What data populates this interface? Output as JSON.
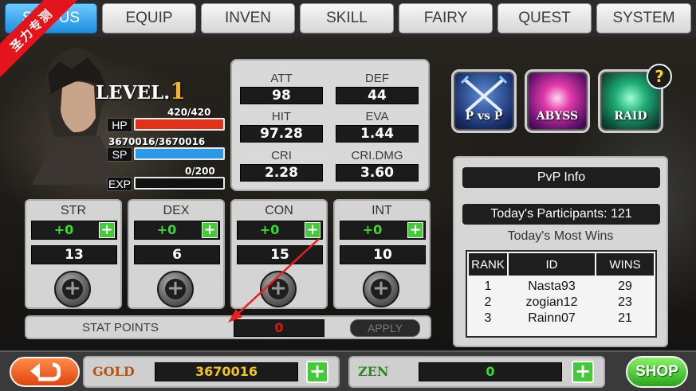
{
  "tabs": [
    {
      "label": "STATUS",
      "active": true
    },
    {
      "label": "EQUIP"
    },
    {
      "label": "INVEN"
    },
    {
      "label": "SKILL"
    },
    {
      "label": "FAIRY"
    },
    {
      "label": "QUEST"
    },
    {
      "label": "SYSTEM"
    }
  ],
  "watermark": "圣力专测",
  "character": {
    "level_label": "LEVEL.",
    "level": "1",
    "hp_label": "HP",
    "hp_value": "420/420",
    "hp_fraction": 1.0,
    "sp_label": "SP",
    "sp_value": "3670016/3670016",
    "sp_fraction": 1.0,
    "exp_label": "EXP",
    "exp_value": "0/200",
    "exp_fraction": 0.0
  },
  "stats": {
    "att_label": "ATT",
    "att": "98",
    "def_label": "DEF",
    "def": "44",
    "hit_label": "HIT",
    "hit": "97.28",
    "eva_label": "EVA",
    "eva": "1.44",
    "cri_label": "CRI",
    "cri": "2.28",
    "cridmg_label": "CRI.DMG",
    "cridmg": "3.60"
  },
  "modes": {
    "pvp": "P vs P",
    "abyss": "ABYSS",
    "raid": "RAID",
    "help": "?"
  },
  "pvp_info": {
    "title": "PvP Info",
    "participants": "Today's Participants: 121",
    "most_wins": "Today's Most Wins",
    "headers": [
      "RANK",
      "ID",
      "WINS"
    ],
    "ranks": [
      "1",
      "2",
      "3"
    ],
    "ids": [
      "Nasta93",
      "zogian12",
      "Rainn07"
    ],
    "wins": [
      "29",
      "23",
      "21"
    ]
  },
  "attributes": {
    "str": {
      "label": "STR",
      "bonus": "+0",
      "value": "13"
    },
    "dex": {
      "label": "DEX",
      "bonus": "+0",
      "value": "6"
    },
    "con": {
      "label": "CON",
      "bonus": "+0",
      "value": "15"
    },
    "int": {
      "label": "INT",
      "bonus": "+0",
      "value": "10"
    }
  },
  "stat_points": {
    "label": "STAT POINTS",
    "value": "0",
    "apply": "APPLY"
  },
  "currency": {
    "gold_label": "GOLD",
    "gold": "3670016",
    "zen_label": "ZEN",
    "zen": "0",
    "shop": "SHOP"
  },
  "colors": {
    "hp": "#e0321a",
    "sp": "#2a9ae6",
    "gold_text": "#f2c324",
    "zen_text": "#3bdc2f",
    "accent_tab": "#1d8fe0"
  }
}
